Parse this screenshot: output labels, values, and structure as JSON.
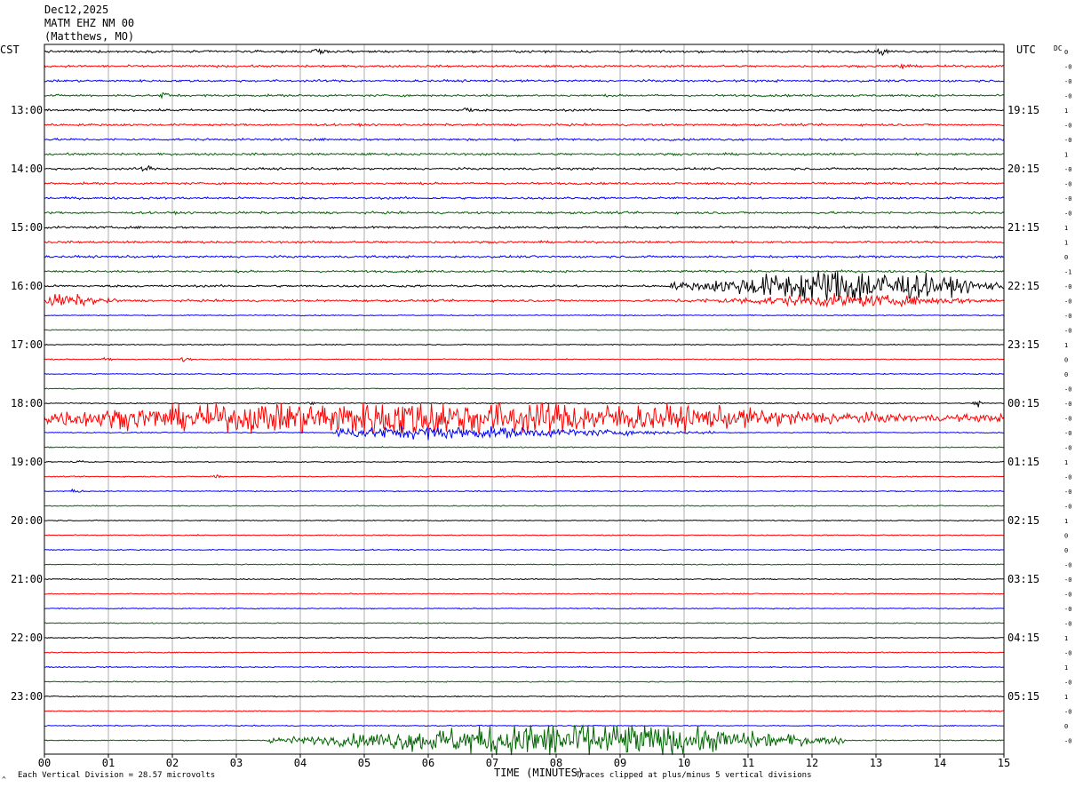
{
  "header": {
    "date": "Dec12,2025",
    "station": "MATM EHZ NM 00",
    "location": "(Matthews, MO)"
  },
  "labels": {
    "left_timezone": "CST",
    "right_timezone": "UTC",
    "dc_header": "DC",
    "footer_scale": "Each Vertical Division =   28.57 microvolts",
    "footer_time": "TIME (MINUTES)",
    "footer_clip": "Traces clipped at plus/minus 5 vertical divisions",
    "corner_mark": "^"
  },
  "colors": {
    "trace_cycle": [
      "#000000",
      "#ff0000",
      "#0000ff",
      "#006400"
    ],
    "gridline": "#999999",
    "frame": "#000000"
  },
  "chart_data": {
    "type": "line",
    "description_type": "helicorder",
    "x_axis": {
      "range": [
        0,
        15
      ],
      "tick_labels": [
        "00",
        "01",
        "02",
        "03",
        "04",
        "05",
        "06",
        "07",
        "08",
        "09",
        "10",
        "11",
        "12",
        "13",
        "14",
        "15"
      ]
    },
    "rows_per_hour": 4,
    "minutes_per_row": 15,
    "row_count": 48,
    "left_hour_labels": [
      "13:00",
      "14:00",
      "15:00",
      "16:00",
      "17:00",
      "18:00",
      "19:00",
      "20:00",
      "21:00",
      "22:00",
      "23:00"
    ],
    "right_hour_labels": [
      "19:15",
      "20:15",
      "21:15",
      "22:15",
      "23:15",
      "00:15",
      "01:15",
      "02:15",
      "03:15",
      "04:15",
      "05:15"
    ],
    "hour_label_first_row": 4,
    "dc_offsets": [
      "0",
      "-0",
      "-0",
      "-0",
      "1",
      "-0",
      "-0",
      "1",
      "-0",
      "-0",
      "-0",
      "-0",
      "1",
      "1",
      "0",
      "-1",
      "-0",
      "-0",
      "-0",
      "-0",
      "1",
      "0",
      "0",
      "-0",
      "-0",
      "-0",
      "-0",
      "-0",
      "1",
      "-0",
      "-0",
      "-0",
      "1",
      "0",
      "0",
      "-0",
      "-0",
      "-0",
      "-0",
      "-0",
      "1",
      "-0",
      "1",
      "-0",
      "1",
      "-0",
      "0",
      "-0"
    ],
    "activity": {
      "base_amplitude_divisions": 0.25,
      "quiet_from_row": 18,
      "quiet_amplitude_divisions": 0.12,
      "clip_divisions": 5,
      "events": [
        {
          "row": 16,
          "start_min": 9.8,
          "end_min": 15,
          "peak_min": 12.5,
          "amp": 4.5
        },
        {
          "row": 17,
          "start_min": 0,
          "end_min": 1.2,
          "peak_min": 0.3,
          "amp": 1.4
        },
        {
          "row": 17,
          "start_min": 9.8,
          "end_min": 15,
          "peak_min": 12.5,
          "amp": 1.3
        },
        {
          "row": 25,
          "start_min": 0,
          "end_min": 15,
          "peak_min": 6.0,
          "amp": 4.8
        },
        {
          "row": 26,
          "start_min": 4.5,
          "end_min": 10.5,
          "peak_min": 6.0,
          "amp": 1.5
        },
        {
          "row": 47,
          "start_min": 3.5,
          "end_min": 12.5,
          "peak_min": 8.2,
          "amp": 4.8
        }
      ],
      "spikes": [
        {
          "row": 0,
          "min": 4.3,
          "amp": 1.0
        },
        {
          "row": 0,
          "min": 13.1,
          "amp": 1.0
        },
        {
          "row": 1,
          "min": 13.4,
          "amp": 0.9
        },
        {
          "row": 3,
          "min": 1.9,
          "amp": 0.9
        },
        {
          "row": 4,
          "min": 6.6,
          "amp": 0.8
        },
        {
          "row": 8,
          "min": 1.6,
          "amp": 0.7
        },
        {
          "row": 21,
          "min": 1.0,
          "amp": 0.6
        },
        {
          "row": 21,
          "min": 2.2,
          "amp": 0.6
        },
        {
          "row": 24,
          "min": 4.2,
          "amp": 0.6
        },
        {
          "row": 24,
          "min": 14.6,
          "amp": 0.9
        },
        {
          "row": 28,
          "min": 0.5,
          "amp": 0.8
        },
        {
          "row": 29,
          "min": 2.7,
          "amp": 0.7
        },
        {
          "row": 30,
          "min": 0.5,
          "amp": 0.6
        }
      ]
    }
  }
}
